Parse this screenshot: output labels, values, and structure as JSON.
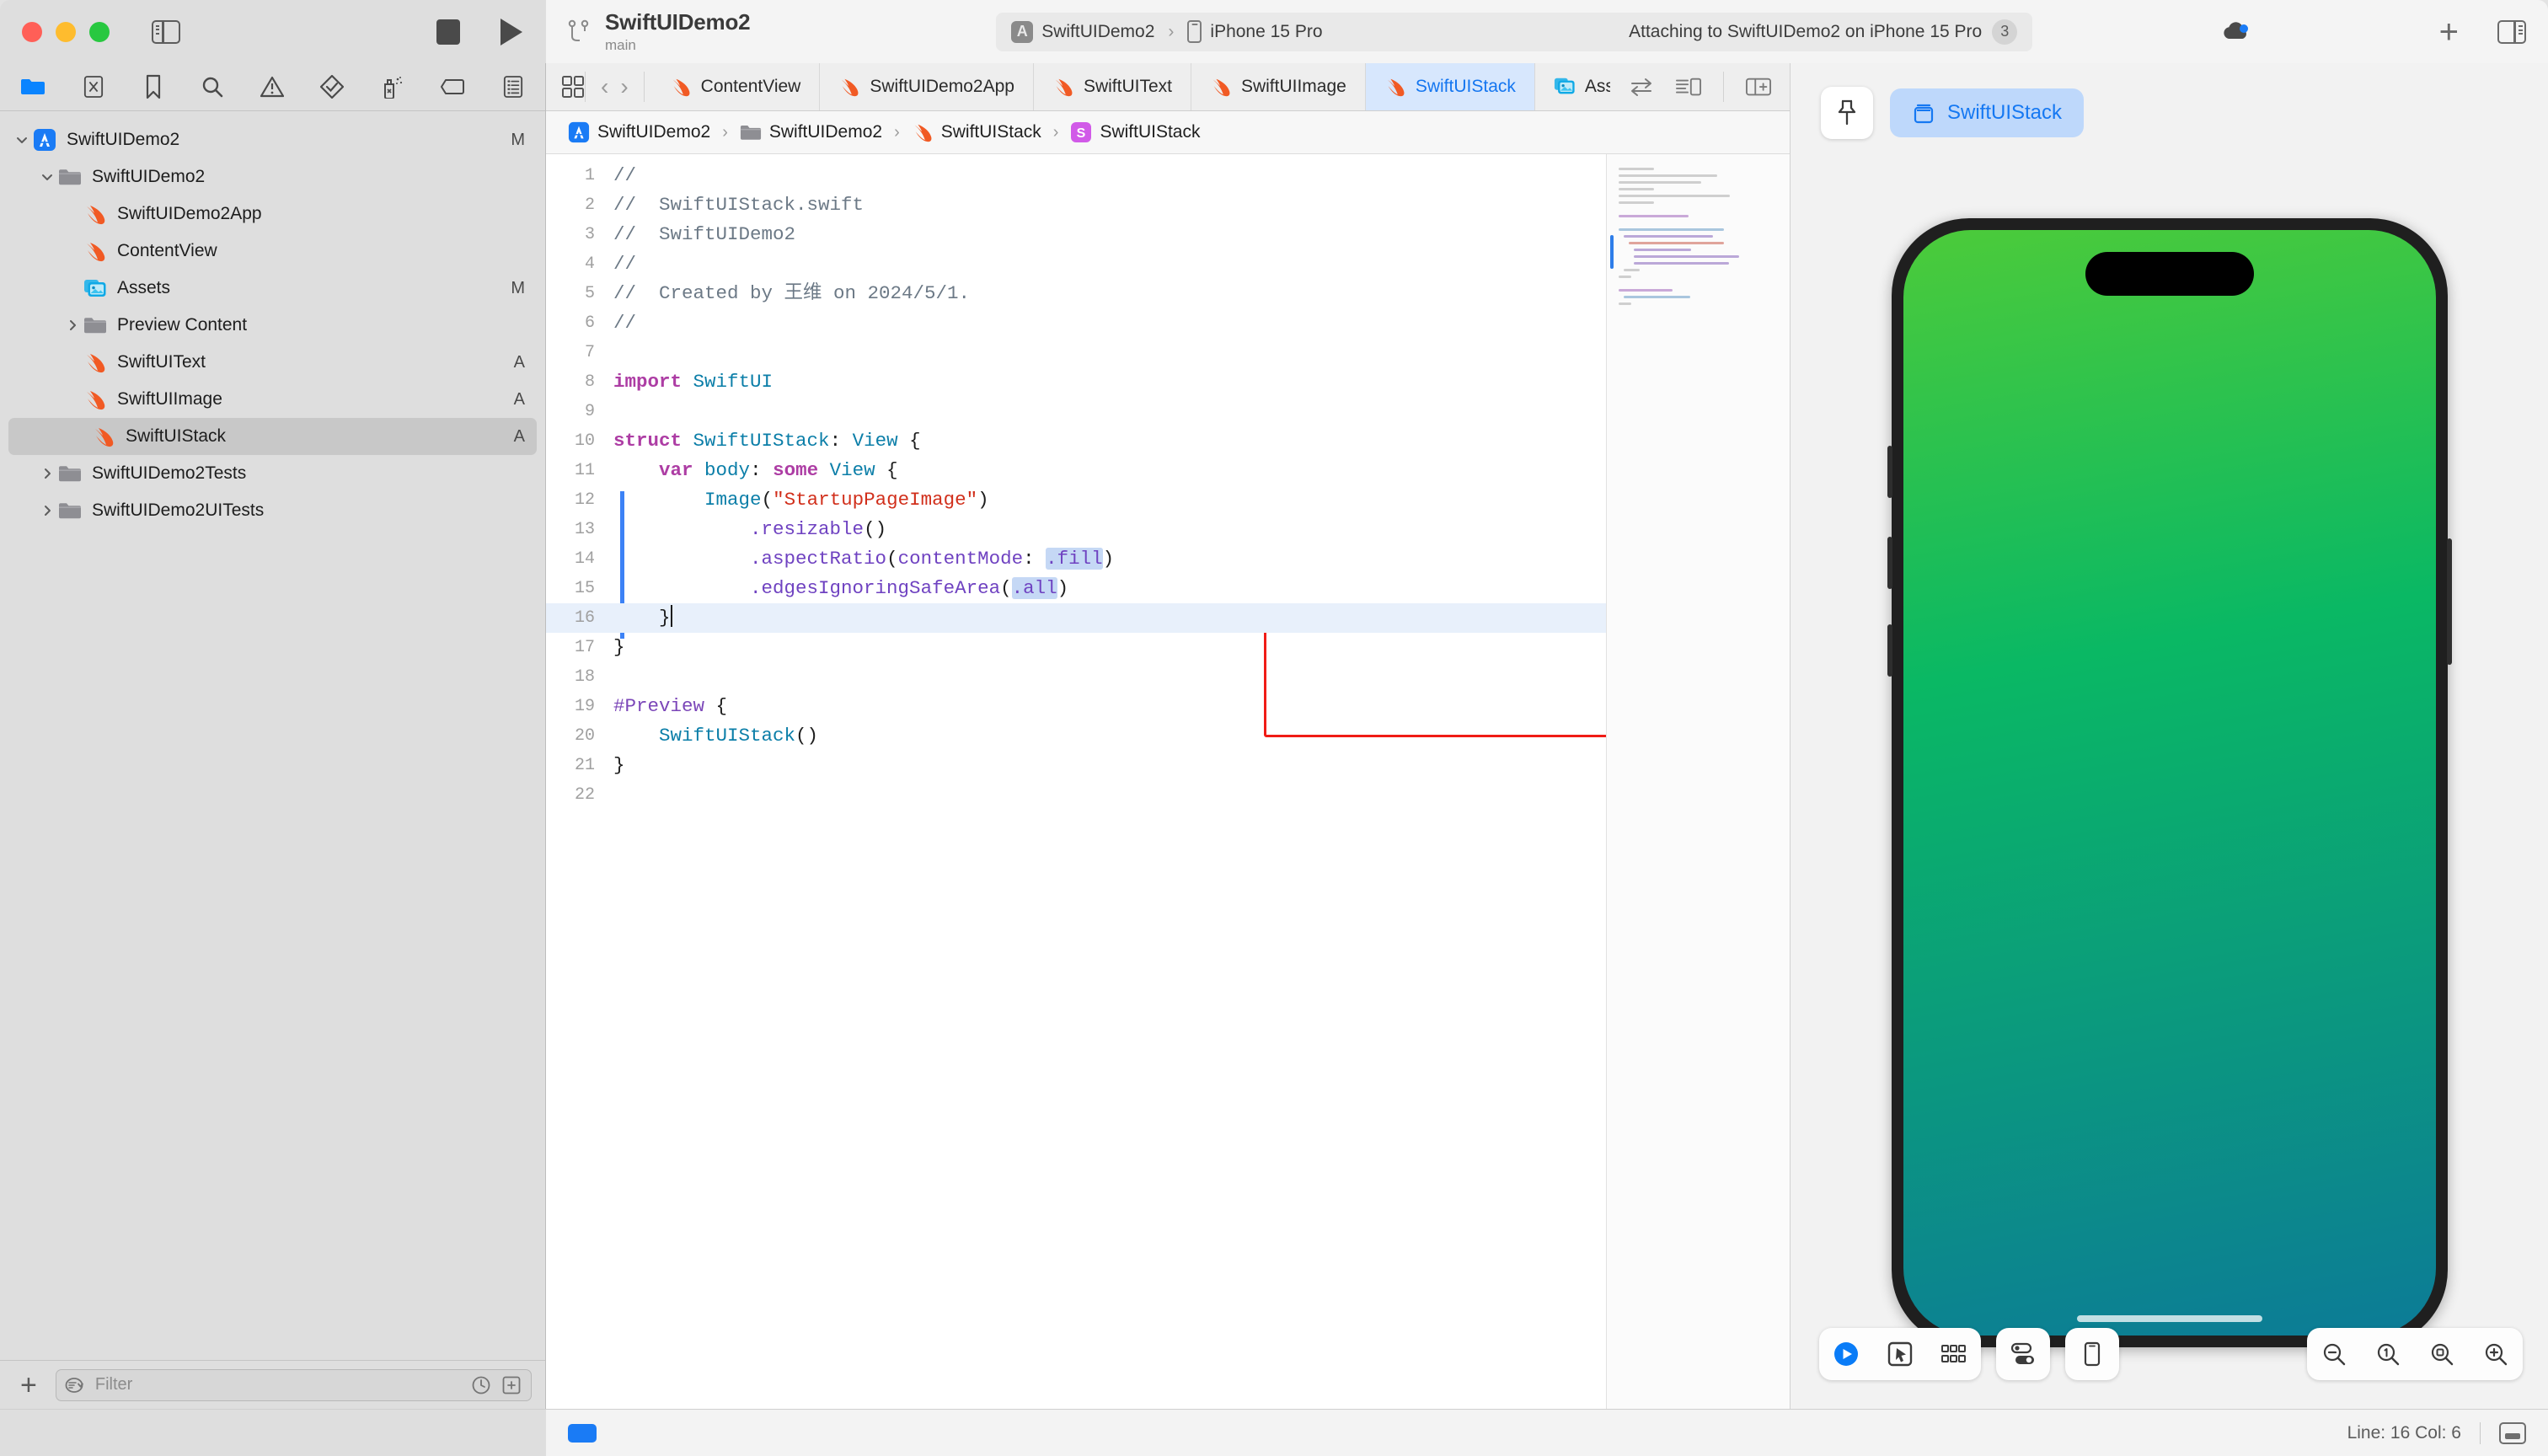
{
  "window": {
    "traffic_lights": [
      "close",
      "minimize",
      "zoom"
    ],
    "scheme_name": "SwiftUIDemo2",
    "branch_name": "main"
  },
  "toolbar": {
    "stop_label": "stop-button",
    "run_label": "run-button",
    "status": {
      "scheme": "SwiftUIDemo2",
      "separator": "›",
      "destination": "iPhone 15 Pro",
      "message": "Attaching to SwiftUIDemo2 on iPhone 15 Pro",
      "issue_count": "3"
    },
    "add_label": "+"
  },
  "navigator": {
    "tabs": [
      "project-navigator-icon",
      "source-control-navigator-icon",
      "bookmark-navigator-icon",
      "find-navigator-icon",
      "issue-navigator-icon",
      "test-navigator-icon",
      "debug-navigator-icon",
      "breakpoint-navigator-icon",
      "report-navigator-icon"
    ],
    "active_tab_index": 0,
    "tree": [
      {
        "label": "SwiftUIDemo2",
        "icon": "xcode-project-icon",
        "depth": 0,
        "twisty": "down",
        "badge": "M",
        "selected": false
      },
      {
        "label": "SwiftUIDemo2",
        "icon": "folder-icon",
        "depth": 1,
        "twisty": "down",
        "badge": "",
        "selected": false
      },
      {
        "label": "SwiftUIDemo2App",
        "icon": "swift-file-icon",
        "depth": 2,
        "twisty": "none",
        "badge": "",
        "selected": false
      },
      {
        "label": "ContentView",
        "icon": "swift-file-icon",
        "depth": 2,
        "twisty": "none",
        "badge": "",
        "selected": false
      },
      {
        "label": "Assets",
        "icon": "assets-catalog-icon",
        "depth": 2,
        "twisty": "none",
        "badge": "M",
        "selected": false
      },
      {
        "label": "Preview Content",
        "icon": "folder-icon",
        "depth": 2,
        "twisty": "right",
        "badge": "",
        "selected": false
      },
      {
        "label": "SwiftUIText",
        "icon": "swift-file-icon",
        "depth": 2,
        "twisty": "none",
        "badge": "A",
        "selected": false
      },
      {
        "label": "SwiftUIImage",
        "icon": "swift-file-icon",
        "depth": 2,
        "twisty": "none",
        "badge": "A",
        "selected": false
      },
      {
        "label": "SwiftUIStack",
        "icon": "swift-file-icon",
        "depth": 2,
        "twisty": "none",
        "badge": "A",
        "selected": true
      },
      {
        "label": "SwiftUIDemo2Tests",
        "icon": "folder-icon",
        "depth": 1,
        "twisty": "right",
        "badge": "",
        "selected": false
      },
      {
        "label": "SwiftUIDemo2UITests",
        "icon": "folder-icon",
        "depth": 1,
        "twisty": "right",
        "badge": "",
        "selected": false
      }
    ],
    "filter_placeholder": "Filter",
    "add_button": "+"
  },
  "editor": {
    "tabs": [
      {
        "label": "ContentView",
        "icon": "swift-file-icon",
        "active": false
      },
      {
        "label": "SwiftUIDemo2App",
        "icon": "swift-file-icon",
        "active": false
      },
      {
        "label": "SwiftUIText",
        "icon": "swift-file-icon",
        "active": false
      },
      {
        "label": "SwiftUIImage",
        "icon": "swift-file-icon",
        "active": false
      },
      {
        "label": "SwiftUIStack",
        "icon": "swift-file-icon",
        "active": true
      },
      {
        "label": "Assets",
        "icon": "assets-catalog-icon",
        "active": false
      }
    ],
    "breadcrumb": [
      {
        "label": "SwiftUIDemo2",
        "icon": "xcode-project-icon"
      },
      {
        "label": "SwiftUIDemo2",
        "icon": "folder-icon"
      },
      {
        "label": "SwiftUIStack",
        "icon": "swift-file-icon"
      },
      {
        "label": "SwiftUIStack",
        "icon": "struct-symbol-icon"
      }
    ],
    "breadcrumb_separator": "›",
    "code_lines": [
      {
        "n": "1",
        "text": "//"
      },
      {
        "n": "2",
        "text": "//  SwiftUIStack.swift"
      },
      {
        "n": "3",
        "text": "//  SwiftUIDemo2"
      },
      {
        "n": "4",
        "text": "//"
      },
      {
        "n": "5",
        "text": "//  Created by 王维 on 2024/5/1."
      },
      {
        "n": "6",
        "text": "//"
      },
      {
        "n": "7",
        "text": ""
      },
      {
        "n": "8",
        "text": "import SwiftUI"
      },
      {
        "n": "9",
        "text": ""
      },
      {
        "n": "10",
        "text": "struct SwiftUIStack: View {"
      },
      {
        "n": "11",
        "text": "    var body: some View {"
      },
      {
        "n": "12",
        "text": "        Image(\"StartupPageImage\")"
      },
      {
        "n": "13",
        "text": "            .resizable()"
      },
      {
        "n": "14",
        "text": "            .aspectRatio(contentMode: .fill)"
      },
      {
        "n": "15",
        "text": "            .edgesIgnoringSafeArea(.all)"
      },
      {
        "n": "16",
        "text": "    }"
      },
      {
        "n": "17",
        "text": "}"
      },
      {
        "n": "18",
        "text": ""
      },
      {
        "n": "19",
        "text": "#Preview {"
      },
      {
        "n": "20",
        "text": "    SwiftUIStack()"
      },
      {
        "n": "21",
        "text": "}"
      },
      {
        "n": "22",
        "text": ""
      }
    ],
    "annotation": {
      "type": "red-rectangle-highlight",
      "color": "#f01c16",
      "covers_lines": "12-15"
    }
  },
  "canvas": {
    "pin_button": "pin-icon",
    "preview_chip_label": "SwiftUIStack",
    "device_name": "iPhone 15 Pro",
    "preview_gradient_top": "#4ccb3a",
    "preview_gradient_mid": "#0ab864",
    "preview_gradient_bottom": "#0c7b97",
    "bottom_controls": [
      "live-preview-play-icon",
      "selectable-pointer-icon",
      "variants-grid-icon",
      "device-settings-toggles-icon",
      "device-picker-icon"
    ],
    "zoom_controls": [
      "zoom-out-icon",
      "zoom-to-actual-size-icon",
      "zoom-to-fit-icon",
      "zoom-in-icon"
    ]
  },
  "statusbar": {
    "line_col": "Line: 16  Col: 6",
    "debug_area_toggle": "debug-area-toggle-icon"
  },
  "colors": {
    "accent_blue": "#1a7bf5",
    "tab_active_bg": "#d7e7fd",
    "annotation_red": "#f01c16",
    "selection_gray": "#c8c8c8"
  }
}
